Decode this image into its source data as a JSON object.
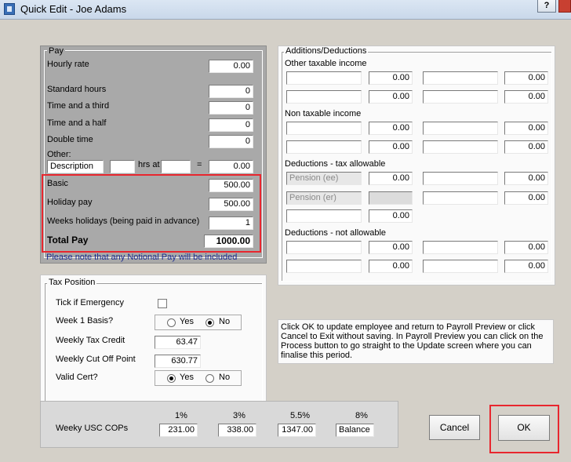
{
  "window": {
    "title": "Quick Edit - Joe Adams",
    "help_label": "?"
  },
  "pay": {
    "legend": "Pay",
    "hourly_rate_label": "Hourly rate",
    "hourly_rate": "0.00",
    "standard_hours_label": "Standard hours",
    "standard_hours": "0",
    "time_and_third_label": "Time and a third",
    "time_and_third": "0",
    "time_and_half_label": "Time and a half",
    "time_and_half": "0",
    "double_time_label": "Double time",
    "double_time": "0",
    "other_label": "Other:",
    "other_description": "Description",
    "other_hours": "",
    "hrs_at_label": "hrs at",
    "other_rate": "",
    "equals_label": "=",
    "other_amount": "0.00",
    "basic_label": "Basic",
    "basic": "500.00",
    "holiday_pay_label": "Holiday pay",
    "holiday_pay": "500.00",
    "weeks_holidays_label": "Weeks holidays (being paid in advance)",
    "weeks_holidays": "1",
    "total_pay_label": "Total Pay",
    "total_pay": "1000.00",
    "notional_note": "Please note that any Notional Pay will be included"
  },
  "additions": {
    "legend": "Additions/Deductions",
    "other_taxable_label": "Other taxable income",
    "non_taxable_label": "Non taxable income",
    "tax_allowable_label": "Deductions - tax allowable",
    "pension_ee": "Pension (ee)",
    "pension_er": "Pension (er)",
    "not_allowable_label": "Deductions - not allowable",
    "zero": "0.00"
  },
  "tax": {
    "legend": "Tax Position",
    "emergency_label": "Tick if Emergency",
    "week1_label": "Week 1 Basis?",
    "yes": "Yes",
    "no": "No",
    "credit_label": "Weekly Tax Credit",
    "credit": "63.47",
    "cutoff_label": "Weekly Cut Off Point",
    "cutoff": "630.77",
    "valid_cert_label": "Valid Cert?"
  },
  "usc": {
    "label": "Weeky USC COPs",
    "bands": [
      {
        "rate": "1%",
        "value": "231.00"
      },
      {
        "rate": "3%",
        "value": "338.00"
      },
      {
        "rate": "5.5%",
        "value": "1347.00"
      },
      {
        "rate": "8%",
        "value": "Balance"
      }
    ]
  },
  "info_text": "Click OK to update employee and return to Payroll Preview or click Cancel to Exit without saving. In Payroll Preview you can click on the Process button to go straight to the Update screen where you can finalise this period.",
  "buttons": {
    "cancel": "Cancel",
    "ok": "OK"
  },
  "highlight_color": "#e8262e"
}
